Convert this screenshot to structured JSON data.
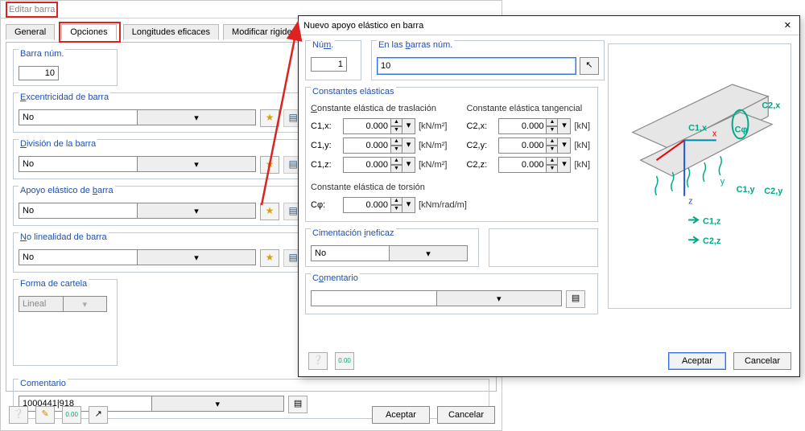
{
  "main": {
    "title": "Editar barra",
    "tabs": {
      "general": "General",
      "opciones": "Opciones",
      "long": "Longitudes eficaces",
      "rig": "Modificar rigidez"
    },
    "barra_num": {
      "title": "Barra núm.",
      "value": "10"
    },
    "exc": {
      "title": "Excentricidad de barra",
      "value": "No"
    },
    "div": {
      "title": "División de la barra",
      "value": "No"
    },
    "apoyo": {
      "title": "Apoyo elástico de barra",
      "value": "No"
    },
    "nolin": {
      "title": "No linealidad de barra",
      "value": "No"
    },
    "forma": {
      "title": "Forma de cartela",
      "value": "Lineal"
    },
    "comen": {
      "title": "Comentario",
      "value": "1000441|918"
    },
    "btn_ok": "Aceptar",
    "btn_cancel": "Cancelar"
  },
  "dlg": {
    "title": "Nuevo apoyo elástico en barra",
    "num": {
      "title": "Núm.",
      "value": "1"
    },
    "bars": {
      "title": "En las barras núm.",
      "value": "10"
    },
    "ce": {
      "title": "Constantes elásticas",
      "trans_head": "Constante elástica de traslación",
      "tang_head": "Constante elástica tangencial",
      "trans": {
        "c1x": {
          "lab": "C1,x:",
          "val": "0.000",
          "unit": "[kN/m²]"
        },
        "c1y": {
          "lab": "C1,y:",
          "val": "0.000",
          "unit": "[kN/m²]"
        },
        "c1z": {
          "lab": "C1,z:",
          "val": "0.000",
          "unit": "[kN/m²]"
        }
      },
      "tang": {
        "c2x": {
          "lab": "C2,x:",
          "val": "0.000",
          "unit": "[kN]"
        },
        "c2y": {
          "lab": "C2,y:",
          "val": "0.000",
          "unit": "[kN]"
        },
        "c2z": {
          "lab": "C2,z:",
          "val": "0.000",
          "unit": "[kN]"
        }
      },
      "tor": {
        "head": "Constante elástica de torsión",
        "lab": "Cφ:",
        "val": "0.000",
        "unit": "[kNm/rad/m]"
      }
    },
    "cim": {
      "title": "Cimentación ineficaz",
      "value": "No"
    },
    "com": {
      "title": "Comentario",
      "value": ""
    },
    "btn_ok": "Aceptar",
    "btn_cancel": "Cancelar"
  },
  "preview_labels": {
    "c2x": "C2,x",
    "cphi": "Cφ",
    "c1x": "C1,x",
    "x": "x",
    "y": "y",
    "z": "z",
    "c1y": "C1,y",
    "c2y": "C2,y",
    "c1z": "C1,z",
    "c2z": "C2,z"
  }
}
